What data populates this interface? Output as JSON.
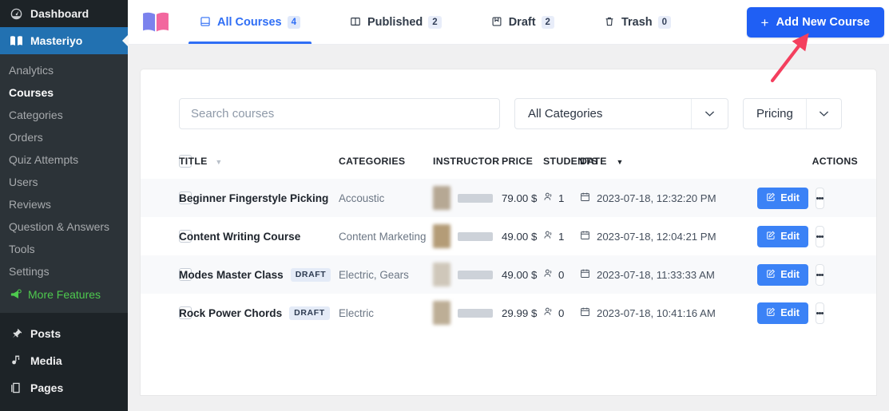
{
  "sidebar": {
    "top_items": [
      {
        "label": "Dashboard",
        "icon": "dashboard-icon",
        "active": false
      },
      {
        "label": "Masteriyo",
        "icon": "book-icon",
        "active": true
      }
    ],
    "sub_items": [
      {
        "label": "Analytics"
      },
      {
        "label": "Courses"
      },
      {
        "label": "Categories"
      },
      {
        "label": "Orders"
      },
      {
        "label": "Quiz Attempts"
      },
      {
        "label": "Users"
      },
      {
        "label": "Reviews"
      },
      {
        "label": "Question & Answers"
      },
      {
        "label": "Tools"
      },
      {
        "label": "Settings"
      },
      {
        "label": "More Features"
      }
    ],
    "bottom_items": [
      {
        "label": "Posts",
        "icon": "pin-icon"
      },
      {
        "label": "Media",
        "icon": "media-icon"
      },
      {
        "label": "Pages",
        "icon": "pages-icon"
      }
    ],
    "current_sub": "Courses",
    "feature_color": "#4ec94e",
    "active_color": "#2271b1"
  },
  "header": {
    "logo_icon": "open-book-logo",
    "tabs": [
      {
        "label": "All Courses",
        "count": "4",
        "icon": "book-closed-icon",
        "active": true
      },
      {
        "label": "Published",
        "count": "2",
        "icon": "book-open-icon",
        "active": false
      },
      {
        "label": "Draft",
        "count": "2",
        "icon": "draft-icon",
        "active": false
      },
      {
        "label": "Trash",
        "count": "0",
        "icon": "trash-icon",
        "active": false
      }
    ],
    "add_button": {
      "label": "Add New Course",
      "icon": "plus-icon"
    },
    "accent_color": "#1f5ff4"
  },
  "filters": {
    "search": {
      "placeholder": "Search courses",
      "value": ""
    },
    "category_select": {
      "value": "All Categories",
      "icon": "chevron-down-icon"
    },
    "pricing_select": {
      "value": "Pricing",
      "icon": "chevron-down-icon"
    }
  },
  "table": {
    "columns": {
      "title": "TITLE",
      "categories": "CATEGORIES",
      "instructor": "INSTRUCTOR",
      "price": "PRICE",
      "students": "STUDENTS",
      "date": "DATE",
      "actions": "ACTIONS"
    },
    "rows": [
      {
        "title": "Beginner Fingerstyle Picking",
        "badge": "",
        "categories": "Accoustic",
        "instructor_avatar_color": "#b6a894",
        "price": "79.00 $",
        "students": "1",
        "date": "2023-07-18, 12:32:20 PM",
        "edit_label": "Edit"
      },
      {
        "title": "Content Writing Course",
        "badge": "",
        "categories": "Content Marketing",
        "instructor_avatar_color": "#b49c77",
        "price": "49.00 $",
        "students": "1",
        "date": "2023-07-18, 12:04:21 PM",
        "edit_label": "Edit"
      },
      {
        "title": "Modes Master Class",
        "badge": "DRAFT",
        "categories": "Electric, Gears",
        "instructor_avatar_color": "#cfc7ba",
        "price": "49.00 $",
        "students": "0",
        "date": "2023-07-18, 11:33:33 AM",
        "edit_label": "Edit"
      },
      {
        "title": "Rock Power Chords",
        "badge": "DRAFT",
        "categories": "Electric",
        "instructor_avatar_color": "#bdae96",
        "price": "29.99 $",
        "students": "0",
        "date": "2023-07-18, 10:41:16 AM",
        "edit_label": "Edit"
      }
    ]
  },
  "annotation": {
    "type": "arrow",
    "color": "#f43f5e"
  }
}
